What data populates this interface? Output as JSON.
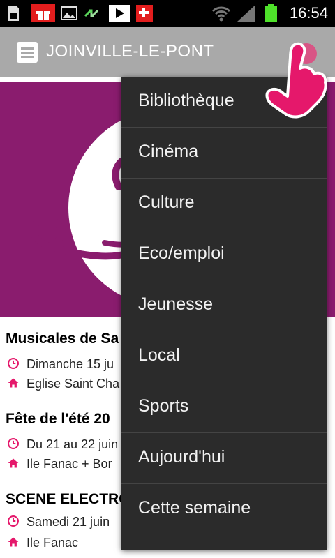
{
  "status_bar": {
    "time": "16:54",
    "icons": [
      "sd-card-icon",
      "gift-icon",
      "image-icon",
      "arrows-icon",
      "play-store-icon",
      "swiss-plus-icon",
      "wifi-icon",
      "signal-icon",
      "battery-icon"
    ]
  },
  "action_bar": {
    "title": "JOINVILLE-LE-PONT",
    "background": "#a9a9a9"
  },
  "banner": {
    "color": "#8a1c6e"
  },
  "events": [
    {
      "title": "Musicales de Sa",
      "date": "Dimanche 15 ju",
      "place": "Eglise Saint Cha"
    },
    {
      "title": "Fête de l'été 20",
      "date": "Du 21 au 22 juin",
      "place": "Ile Fanac + Bor"
    },
    {
      "title": "SCENE ELECTRO",
      "date": "Samedi 21 juin",
      "place": "Ile Fanac"
    }
  ],
  "menu": {
    "items": [
      "Bibliothèque",
      "Cinéma",
      "Culture",
      "Eco/emploi",
      "Jeunesse",
      "Local",
      "Sports",
      "Aujourd'hui",
      "Cette semaine"
    ]
  },
  "colors": {
    "accent": "#e5186b",
    "menu_bg": "#2b2b2b"
  }
}
